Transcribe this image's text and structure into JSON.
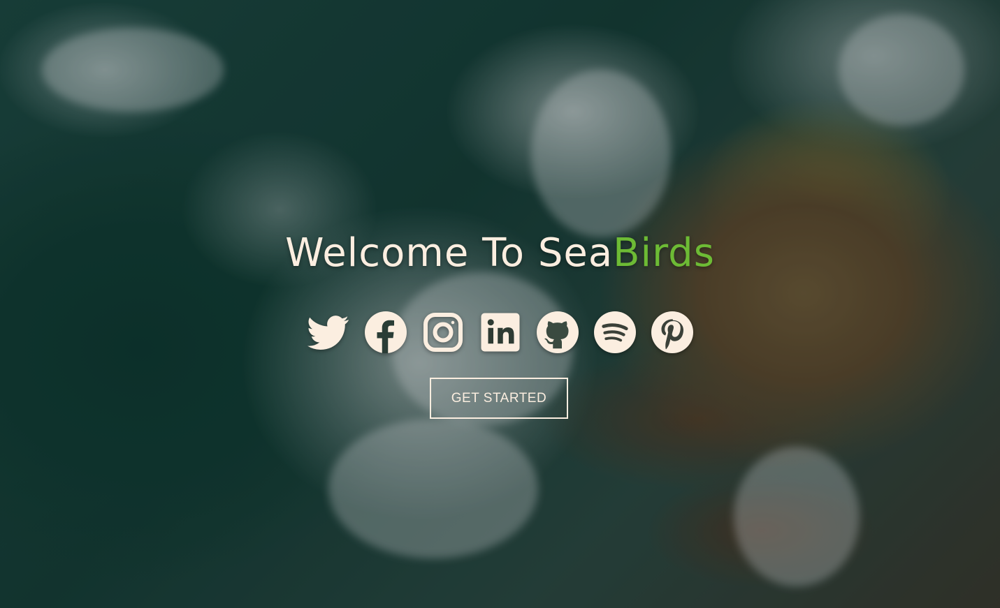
{
  "hero": {
    "title_main": "Welcome To Sea",
    "title_accent": "Birds",
    "accent_color": "#6dbb35",
    "text_color": "#fbeee0"
  },
  "socials": [
    {
      "icon": "twitter-icon"
    },
    {
      "icon": "facebook-icon"
    },
    {
      "icon": "instagram-icon"
    },
    {
      "icon": "linkedin-icon"
    },
    {
      "icon": "github-icon"
    },
    {
      "icon": "spotify-icon"
    },
    {
      "icon": "pinterest-icon"
    }
  ],
  "cta": {
    "label": "GET STARTED"
  }
}
